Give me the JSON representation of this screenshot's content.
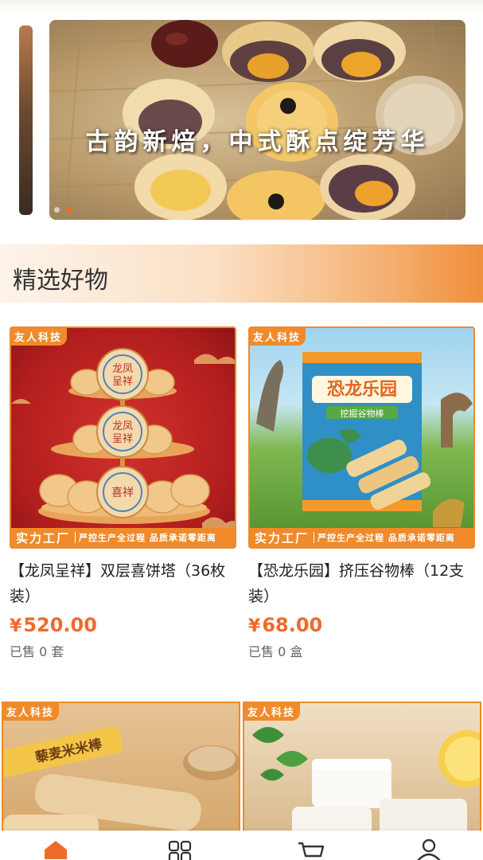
{
  "banner": {
    "slogan": "古韵新焙，中式酥点绽芳华",
    "dots": 2,
    "active_dot": 1
  },
  "section": {
    "title": "精选好物"
  },
  "products": [
    {
      "brand_tag": "友人科技",
      "promo_strong": "实力工厂",
      "promo_text": "严控生产全过程 品质承诺零距离",
      "name": "【龙凤呈祥】双层喜饼塔（36枚装）",
      "currency": "¥",
      "price": "520.00",
      "sold": "已售 0 套",
      "image_text": [
        "龙凤",
        "呈祥",
        "喜祥"
      ]
    },
    {
      "brand_tag": "友人科技",
      "promo_strong": "实力工厂",
      "promo_text": "严控生产全过程 品质承诺零距离",
      "name": "【恐龙乐园】挤压谷物棒（12支装）",
      "currency": "¥",
      "price": "68.00",
      "sold": "已售 0 盒",
      "image_text": [
        "恐龙乐园",
        "挖掘谷物棒"
      ]
    },
    {
      "brand_tag": "友人科技",
      "image_text": "藜麦米米棒"
    },
    {
      "brand_tag": "友人科技"
    }
  ],
  "tabbar": {
    "items": [
      "home-icon",
      "category-icon",
      "cart-icon",
      "profile-icon"
    ],
    "active": 0
  },
  "colors": {
    "accent": "#f08a2a",
    "price": "#f06a2b"
  }
}
